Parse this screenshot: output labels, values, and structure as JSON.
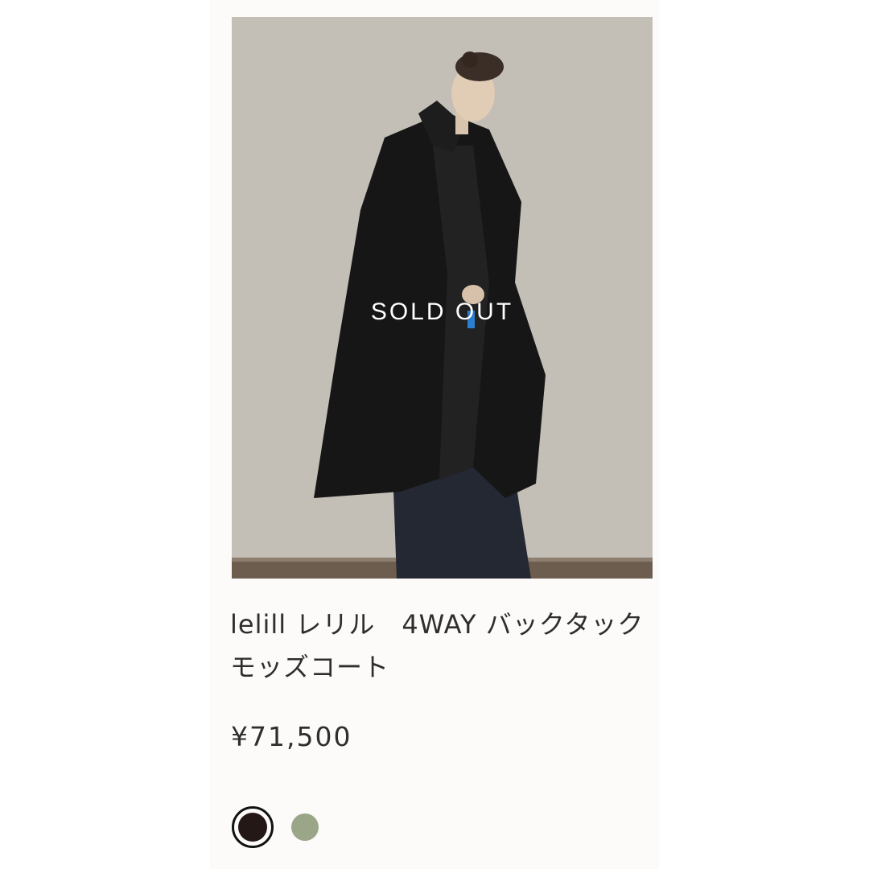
{
  "product": {
    "sold_out_label": "SOLD OUT",
    "title": "lelill レリル　4WAY バックタックモッズコート",
    "price": "¥71,500",
    "image_icon": "model-wearing-black-mods-coat"
  },
  "colors": {
    "swatches": [
      {
        "name": "dark-brown",
        "color": "#231815",
        "selected": true
      },
      {
        "name": "khaki",
        "color": "#9ba689",
        "selected": false
      }
    ]
  }
}
